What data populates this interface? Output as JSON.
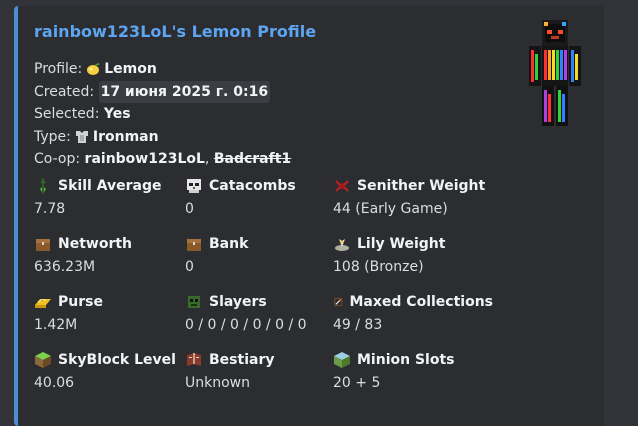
{
  "embed": {
    "title": "rainbow123LoL's Lemon Profile",
    "accent_color": "#4e8cd8"
  },
  "info": {
    "profile_label": "Profile:",
    "profile_value": "Lemon",
    "profile_icon": "lemon-icon",
    "created_label": "Created:",
    "created_value": "17 июня 2025 г. 0:16",
    "selected_label": "Selected:",
    "selected_value": "Yes",
    "type_label": "Type:",
    "type_value": "Ironman",
    "type_icon": "iron-chestplate-icon",
    "coop_label": "Co-op:",
    "coop_member_1": "rainbow123LoL",
    "coop_separator": ",",
    "coop_member_2": "Badcraft1"
  },
  "fields": [
    {
      "name": "Skill Average",
      "value": "7.78",
      "icon": "skill-average-icon"
    },
    {
      "name": "Catacombs",
      "value": "0",
      "icon": "skull-icon"
    },
    {
      "name": "Senither Weight",
      "value": "44 (Early Game)",
      "icon": "senither-weight-icon"
    },
    {
      "name": "Networth",
      "value": "636.23M",
      "icon": "chest-icon"
    },
    {
      "name": "Bank",
      "value": "0",
      "icon": "bank-chest-icon"
    },
    {
      "name": "Lily Weight",
      "value": "108 (Bronze)",
      "icon": "lily-weight-icon"
    },
    {
      "name": "Purse",
      "value": "1.42M",
      "icon": "gold-ingot-icon"
    },
    {
      "name": "Slayers",
      "value": "0 / 0 / 0 / 0 / 0 / 0",
      "icon": "slayer-icon"
    },
    {
      "name": "Maxed Collections",
      "value": "49 / 83",
      "icon": "collections-icon"
    },
    {
      "name": "SkyBlock Level",
      "value": "40.06",
      "icon": "skyblock-level-icon"
    },
    {
      "name": "Bestiary",
      "value": "Unknown",
      "icon": "bestiary-icon"
    },
    {
      "name": "Minion Slots",
      "value": "20 + 5",
      "icon": "minion-slots-icon"
    }
  ]
}
